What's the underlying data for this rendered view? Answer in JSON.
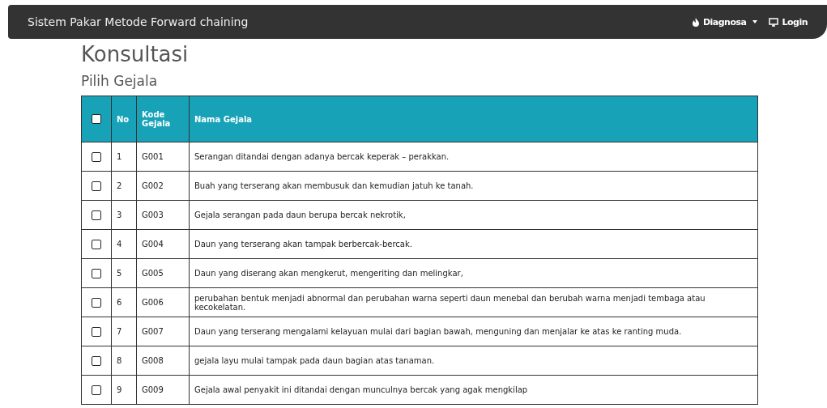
{
  "navbar": {
    "brand": "Sistem Pakar Metode Forward chaining",
    "menu": [
      {
        "label": "Diagnosa",
        "kind": "dropdown"
      },
      {
        "label": "Login",
        "kind": "link"
      }
    ]
  },
  "page_title": "Konsultasi",
  "section_title": "Pilih Gejala",
  "table": {
    "select_all_checked": false,
    "columns": [
      "No",
      "Kode Gejala",
      "Nama Gejala"
    ],
    "rows": [
      {
        "checked": false,
        "no": "1",
        "code": "G001",
        "name": "Serangan ditandai dengan adanya bercak keperak – perakkan."
      },
      {
        "checked": false,
        "no": "2",
        "code": "G002",
        "name": "Buah yang terserang akan membusuk dan kemudian jatuh ke tanah."
      },
      {
        "checked": false,
        "no": "3",
        "code": "G003",
        "name": "Gejala serangan pada daun berupa bercak nekrotik,"
      },
      {
        "checked": false,
        "no": "4",
        "code": "G004",
        "name": "Daun yang terserang akan tampak berbercak-bercak."
      },
      {
        "checked": false,
        "no": "5",
        "code": "G005",
        "name": "Daun yang diserang akan mengkerut, mengeriting dan melingkar,"
      },
      {
        "checked": false,
        "no": "6",
        "code": "G006",
        "name": "perubahan bentuk menjadi abnormal dan perubahan warna seperti daun menebal dan berubah warna menjadi tembaga atau kecokelatan."
      },
      {
        "checked": false,
        "no": "7",
        "code": "G007",
        "name": "Daun yang terserang mengalami kelayuan mulai dari bagian bawah, menguning dan menjalar ke atas ke ranting muda."
      },
      {
        "checked": false,
        "no": "8",
        "code": "G008",
        "name": "gejala layu mulai tampak pada daun bagian atas tanaman."
      },
      {
        "checked": false,
        "no": "9",
        "code": "G009",
        "name": "Gejala awal penyakit ini ditandai dengan munculnya bercak yang agak mengkilap"
      }
    ]
  }
}
